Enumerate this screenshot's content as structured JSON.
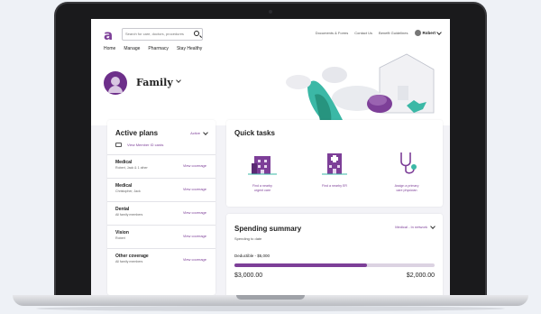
{
  "header": {
    "logo": "a",
    "search_placeholder": "Search for care, doctors, procedures",
    "links": [
      "Documents & Forms",
      "Contact Us",
      "Benefit Guidelines"
    ],
    "user": "Robert"
  },
  "nav": [
    "Home",
    "Manage",
    "Pharmacy",
    "Stay Healthy"
  ],
  "family": {
    "title": "Family"
  },
  "plans": {
    "title": "Active plans",
    "filter": "Active",
    "id_cards": "View Member ID cards",
    "rows": [
      {
        "name": "Medical",
        "sub": "Robert, Jack & 1 other",
        "link": "View coverage"
      },
      {
        "name": "Medical",
        "sub": "Christopher, Jack",
        "link": "View coverage"
      },
      {
        "name": "Dental",
        "sub": "All family members",
        "link": "View coverage"
      },
      {
        "name": "Vision",
        "sub": "Robert",
        "link": "View coverage"
      },
      {
        "name": "Other coverage",
        "sub": "All family members",
        "link": "View coverage"
      }
    ]
  },
  "tasks": {
    "title": "Quick tasks",
    "items": [
      {
        "line1": "Find a nearby",
        "line2": "urgent care",
        "icon": "urgent-care-building-icon"
      },
      {
        "line1": "Find a nearby ER",
        "line2": "",
        "icon": "hospital-icon"
      },
      {
        "line1": "Assign a primary",
        "line2": "care physician",
        "icon": "stethoscope-icon"
      }
    ]
  },
  "spending": {
    "title": "Spending summary",
    "subtitle": "Spending to date",
    "filter": "Medical - In network",
    "deductible": "Deductible - $5,000",
    "progress": 0.66,
    "amount_left": "$3,000.00",
    "amount_right": "$2,000.00"
  },
  "colors": {
    "brand": "#7d3f98",
    "bar_track": "#dcd3e2"
  }
}
